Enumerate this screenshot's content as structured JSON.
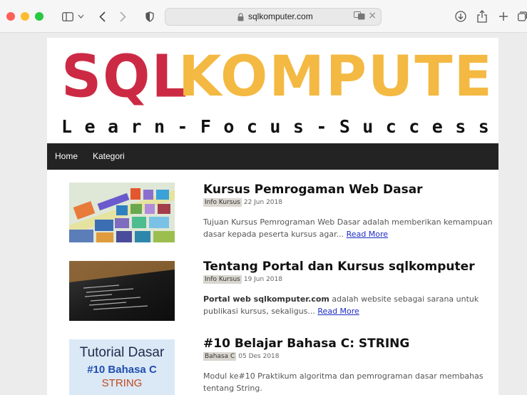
{
  "browser": {
    "url": "sqlkomputer.com"
  },
  "site": {
    "logo_part1": "SQL",
    "logo_part2": "KOMPUTER",
    "tagline": [
      "L",
      "e",
      "a",
      "r",
      "n",
      "-",
      "F",
      "o",
      "c",
      "u",
      "s",
      "-",
      "S",
      "u",
      "c",
      "c",
      "e",
      "s",
      "s"
    ]
  },
  "nav": {
    "home": "Home",
    "kategori": "Kategori"
  },
  "posts": [
    {
      "title": "Kursus Pemrogaman Web Dasar",
      "category": "Info Kursus",
      "date": "22 Jun 2018",
      "excerpt_bold": "",
      "excerpt": "Tujuan Kursus Pemrograman Web Dasar adalah memberikan kemampuan dasar kepada peserta kursus agar...",
      "read_more": "Read More"
    },
    {
      "title": "Tentang Portal dan Kursus sqlkomputer",
      "category": "Info Kursus",
      "date": "19 Jun 2018",
      "excerpt_bold": "Portal web sqlkomputer.com",
      "excerpt": "adalah website sebagai sarana untuk publikasi kursus, sekaligus...",
      "read_more": "Read More"
    },
    {
      "title": "#10 Belajar Bahasa C: STRING",
      "category": "Bahasa C",
      "date": "05 Des 2018",
      "excerpt_bold": "",
      "excerpt": "Modul ke#10 Praktikum algoritma dan pemrograman dasar membahas tentang String.",
      "read_more": ""
    }
  ],
  "thumb3": {
    "line1": "Tutorial Dasar",
    "line2": "#10 Bahasa C",
    "line3": "STRING"
  },
  "colors": {
    "logo_red": "#cc2a44",
    "logo_yellow": "#f4b942",
    "nav_bg": "#232323",
    "link": "#1d2cc4"
  }
}
